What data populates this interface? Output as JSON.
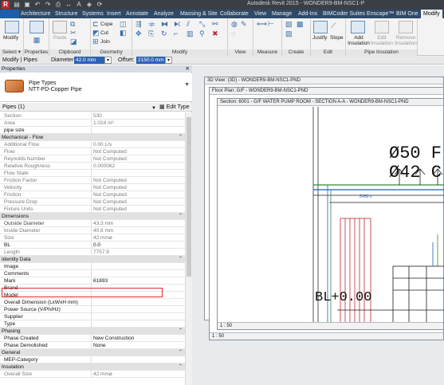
{
  "titlebar": {
    "logo": "R",
    "title": "Autodesk Revit 2015 - WONDER9-BM-NSC1-P"
  },
  "ribbon_tabs": {
    "file": "",
    "items": [
      "Architecture",
      "Structure",
      "Systems",
      "Insert",
      "Annotate",
      "Analyze",
      "Massing & Site",
      "Collaborate",
      "View",
      "Manage",
      "Add-Ins",
      "BIMCoder Suites",
      "Enscape™",
      "BIM One",
      "Modify"
    ]
  },
  "ribbon": {
    "modify_label": "Modify",
    "panels": [
      "Select ▾",
      "Properties",
      "Clipboard",
      "Geometry",
      "Modify",
      "View",
      "Measure",
      "Create",
      "Edit",
      "Pipe Insulation"
    ],
    "clipboard": {
      "paste": "Paste",
      "cope": "Cope",
      "cut": "Cut",
      "join": "Join"
    },
    "edit": {
      "justify": "Justify",
      "slope": "Slope"
    },
    "insulation": {
      "add": "Add Insulation",
      "edit": "Edit Insulation",
      "remove": "Remove Insulation"
    }
  },
  "optbar": {
    "context": "Modify | Pipes",
    "diameter_label": "Diameter:",
    "diameter_value": "42.0 mm",
    "offset_label": "Offset:",
    "offset_value": "2150.0 mm"
  },
  "props": {
    "header": "Properties",
    "family": "Pipe Types",
    "type": "NTT-PD-Copper Pipe",
    "instance": "Pipes (1)",
    "edit_type": "Edit Type",
    "rows": [
      {
        "k": "Section",
        "v": "530",
        "kind": "ro"
      },
      {
        "k": "Area",
        "v": "1.024 m²",
        "kind": "ro"
      },
      {
        "k": "pipe size",
        "v": "",
        "kind": "ed"
      },
      {
        "k": "Mechanical - Flow",
        "v": "",
        "kind": "group"
      },
      {
        "k": "Additional Flow",
        "v": "0.00 L/s",
        "kind": "ro"
      },
      {
        "k": "Flow",
        "v": "Not Computed",
        "kind": "ro"
      },
      {
        "k": "Reynolds Number",
        "v": "Not Computed",
        "kind": "ro"
      },
      {
        "k": "Relative Roughness",
        "v": "0.000062",
        "kind": "ro"
      },
      {
        "k": "Flow State",
        "v": "",
        "kind": "ro"
      },
      {
        "k": "Friction Factor",
        "v": "Not Computed",
        "kind": "ro"
      },
      {
        "k": "Velocity",
        "v": "Not Computed",
        "kind": "ro"
      },
      {
        "k": "Friction",
        "v": "Not Computed",
        "kind": "ro"
      },
      {
        "k": "Pressure Drop",
        "v": "Not Computed",
        "kind": "ro"
      },
      {
        "k": "Fixture Units",
        "v": "Not Computed",
        "kind": "ro"
      },
      {
        "k": "Dimensions",
        "v": "",
        "kind": "group"
      },
      {
        "k": "Outside Diameter",
        "v": "43.3 mm",
        "kind": "ro"
      },
      {
        "k": "Inside Diameter",
        "v": "40.8 mm",
        "kind": "ro"
      },
      {
        "k": "Size",
        "v": "42 mmø",
        "kind": "ro"
      },
      {
        "k": "BL",
        "v": "0.0",
        "kind": "ed"
      },
      {
        "k": "Length",
        "v": "7757.9",
        "kind": "ro"
      },
      {
        "k": "Identity Data",
        "v": "",
        "kind": "group"
      },
      {
        "k": "Image",
        "v": "",
        "kind": "ed"
      },
      {
        "k": "Comments",
        "v": "",
        "kind": "ed"
      },
      {
        "k": "Mark",
        "v": "61893",
        "kind": "ed"
      },
      {
        "k": "Brand",
        "v": "",
        "kind": "ed"
      },
      {
        "k": "Model",
        "v": "",
        "kind": "ed"
      },
      {
        "k": "Overall Dimension (LxWxH mm)",
        "v": "",
        "kind": "ed"
      },
      {
        "k": "Power Source (V/Ph/Hz)",
        "v": "",
        "kind": "ed"
      },
      {
        "k": "Supplier",
        "v": "",
        "kind": "ed"
      },
      {
        "k": "Type",
        "v": "",
        "kind": "ed"
      },
      {
        "k": "Phasing",
        "v": "",
        "kind": "group"
      },
      {
        "k": "Phase Created",
        "v": "New Construction",
        "kind": "ed"
      },
      {
        "k": "Phase Demolished",
        "v": "None",
        "kind": "ed"
      },
      {
        "k": "General",
        "v": "",
        "kind": "group"
      },
      {
        "k": "MEP-Category",
        "v": "",
        "kind": "ed"
      },
      {
        "k": "Insulation",
        "v": "",
        "kind": "group"
      },
      {
        "k": "Overall Size",
        "v": "42 mmø",
        "kind": "ro"
      }
    ]
  },
  "views": {
    "v3d": "3D View: {3D} - WONDER9-BM-NSC1-PND",
    "floor": "Floor Plan: G/F - WONDER9-BM-NSC1-PND",
    "section": "Section: 6001 - G/F WATER PUMP ROOM - SECTION A-A - WONDER9-BM-NSC1-PND",
    "scale": "1 : 50",
    "scale_inner": "1 : 50",
    "annot_1": "Ø50 F",
    "annot_2": "Ø42 C",
    "annot_bl": "BL+0.00",
    "pipe_tag": "Z450 n"
  },
  "colors": {
    "accent": "#2e63b4",
    "highlight": "#e0292c",
    "pipe": "#c0642b"
  }
}
